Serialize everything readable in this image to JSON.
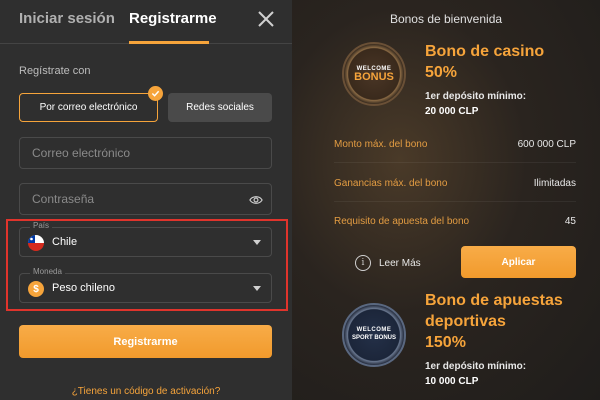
{
  "tabs": {
    "login": "Iniciar sesión",
    "register": "Registrarme"
  },
  "register_with": "Regístrate con",
  "methods": {
    "email": "Por correo electrónico",
    "social": "Redes sociales"
  },
  "fields": {
    "email_placeholder": "Correo electrónico",
    "password_placeholder": "Contraseña"
  },
  "country": {
    "label": "País",
    "value": "Chile"
  },
  "currency": {
    "label": "Moneda",
    "value": "Peso chileno",
    "symbol": "$"
  },
  "submit_label": "Registrarme",
  "activation_link": "¿Tienes un código de activación?",
  "bonuses_title": "Bonos de bienvenida",
  "casino_bonus": {
    "badge_top": "WELCOME",
    "badge_main": "BONUS",
    "title_line1": "Bono de casino",
    "title_line2": "50%",
    "min_deposit_label": "1er depósito mínimo:",
    "min_deposit_value": "20 000 CLP",
    "rows": [
      {
        "label": "Monto máx. del bono",
        "value": "600 000 CLP"
      },
      {
        "label": "Ganancias máx. del bono",
        "value": "Ilimitadas"
      },
      {
        "label": "Requisito de apuesta del bono",
        "value": "45"
      }
    ],
    "more_label": "Leer Más",
    "apply_label": "Aplicar"
  },
  "sport_bonus": {
    "badge_top": "WELCOME",
    "badge_main": "SPORT BONUS",
    "title_line1": "Bono de apuestas",
    "title_line2": "deportivas",
    "title_line3": "150%",
    "min_deposit_label": "1er depósito mínimo:",
    "min_deposit_value": "10 000 CLP"
  },
  "colors": {
    "accent": "#f6a43b",
    "highlight_border": "#e0342c"
  }
}
